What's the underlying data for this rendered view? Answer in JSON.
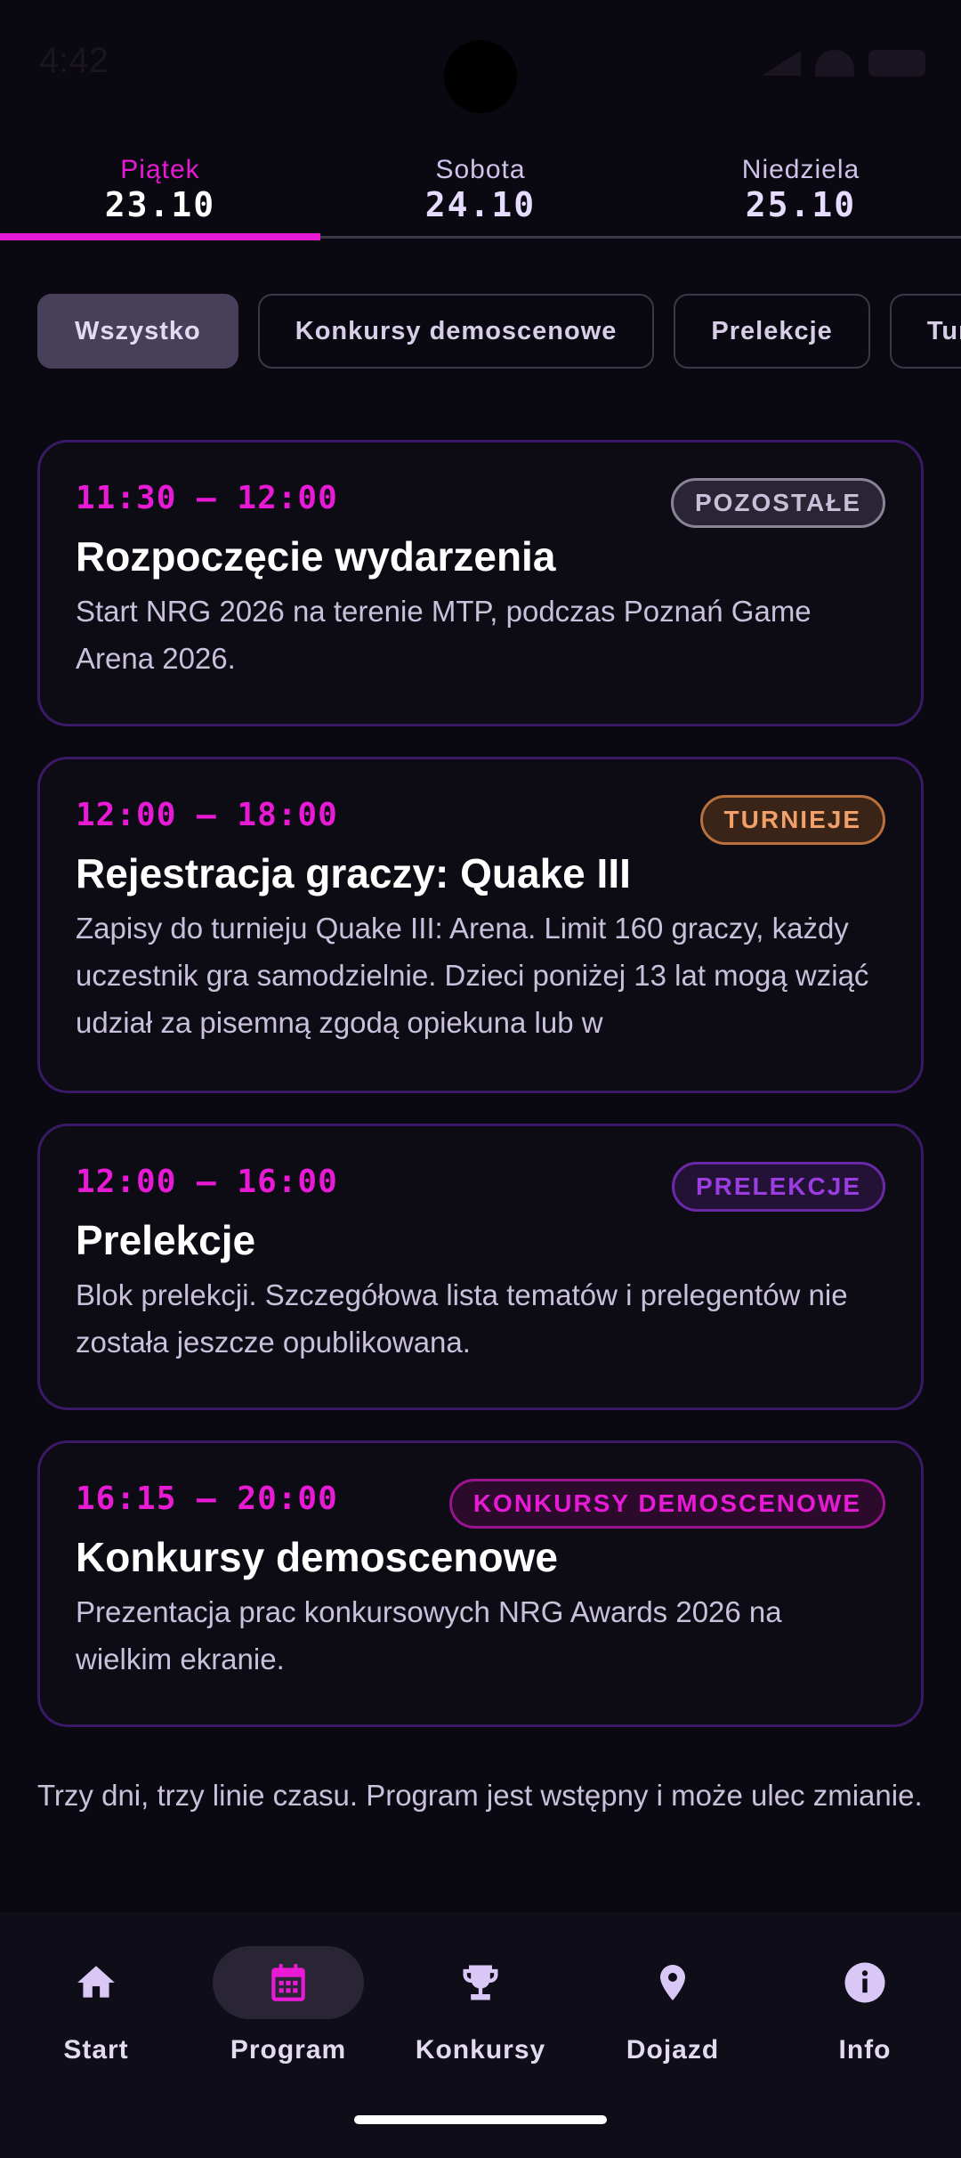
{
  "status_bar": {
    "time": "4:42"
  },
  "days": [
    {
      "name": "Piątek",
      "date": "23.10",
      "active": true
    },
    {
      "name": "Sobota",
      "date": "24.10",
      "active": false
    },
    {
      "name": "Niedziela",
      "date": "25.10",
      "active": false
    }
  ],
  "filters": [
    "Wszystko",
    "Konkursy demoscenowe",
    "Prelekcje",
    "Turnieje"
  ],
  "events": [
    {
      "time": "11:30 – 12:00",
      "badge": "POZOSTAŁE",
      "title": "Rozpoczęcie wydarzenia",
      "description": "Start NRG 2026 na terenie MTP, podczas Poznań Game Arena 2026."
    },
    {
      "time": "12:00 – 18:00",
      "badge": "TURNIEJE",
      "title": "Rejestracja graczy: Quake III",
      "description": "Zapisy do turnieju Quake III: Arena. Limit 160 graczy, każdy uczestnik gra samodzielnie. Dzieci poniżej 13 lat mogą wziąć udział za pisemną zgodą opiekuna lub w"
    },
    {
      "time": "12:00 – 16:00",
      "badge": "PRELEKCJE",
      "title": "Prelekcje",
      "description": "Blok prelekcji. Szczegółowa lista tematów i prelegentów nie została jeszcze opublikowana."
    },
    {
      "time": "16:15 – 20:00",
      "badge": "KONKURSY DEMOSCENOWE",
      "title": "Konkursy demoscenowe",
      "description": "Prezentacja prac konkursowych NRG Awards 2026 na wielkim ekranie."
    }
  ],
  "footnote": "Trzy dni, trzy linie czasu. Program jest wstępny i może ulec zmianie.",
  "nav": [
    {
      "label": "Start",
      "icon": "home-icon"
    },
    {
      "label": "Program",
      "icon": "calendar-icon",
      "active": true
    },
    {
      "label": "Konkursy",
      "icon": "trophy-icon"
    },
    {
      "label": "Dojazd",
      "icon": "map-pin-icon"
    },
    {
      "label": "Info",
      "icon": "info-icon"
    }
  ],
  "colors": {
    "accent": "#e81ad6",
    "background": "#0a0810",
    "card_border": "#3a1a66"
  }
}
